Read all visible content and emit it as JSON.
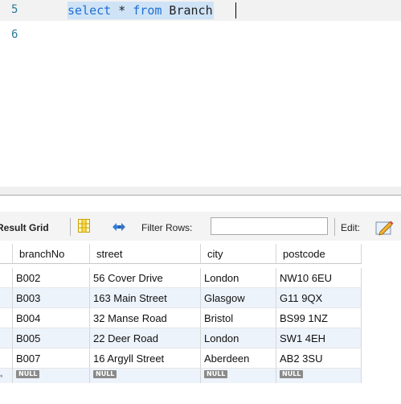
{
  "editor": {
    "lines": [
      {
        "number": "5",
        "keyword1": "select",
        "symbol": " * ",
        "keyword2": "from",
        "table": " Branch"
      },
      {
        "number": "6"
      }
    ]
  },
  "toolbar": {
    "result_grid_label": "Result Grid",
    "filter_rows_label": "Filter Rows:",
    "filter_value": "",
    "edit_label": "Edit:"
  },
  "grid": {
    "columns": [
      "branchNo",
      "street",
      "city",
      "postcode"
    ],
    "rows": [
      [
        "B002",
        "56 Cover Drive",
        "London",
        "NW10 6EU"
      ],
      [
        "B003",
        "163 Main Street",
        "Glasgow",
        "G11 9QX"
      ],
      [
        "B004",
        "32 Manse Road",
        "Bristol",
        "BS99 1NZ"
      ],
      [
        "B005",
        "22 Deer Road",
        "London",
        "SW1 4EH"
      ],
      [
        "B007",
        "16 Argyll Street",
        "Aberdeen",
        "AB2 3SU"
      ]
    ],
    "null_label": "NULL",
    "new_row_marker": "*"
  },
  "colors": {
    "keyword": "#1f6fd0",
    "selection": "#cfe3f7",
    "alt_row": "#edf3fb",
    "line_number": "#2b7a9a"
  }
}
